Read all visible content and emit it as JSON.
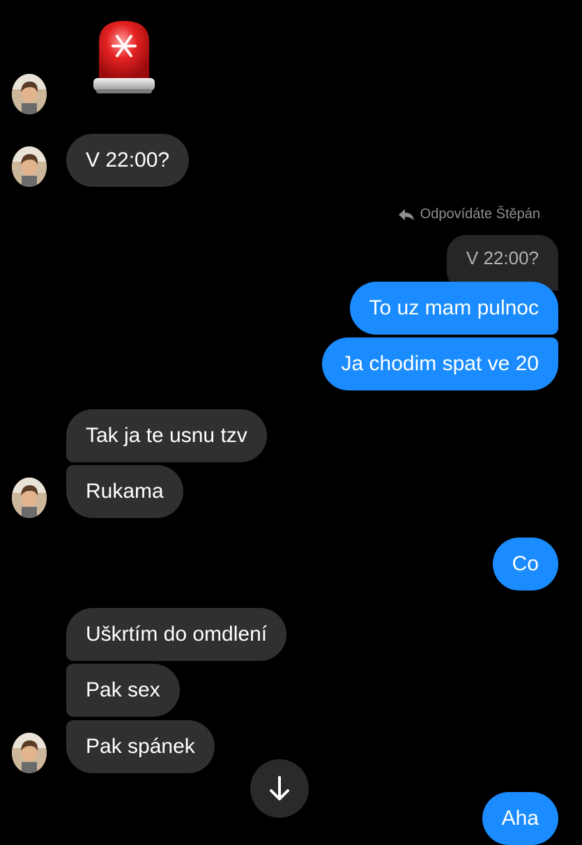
{
  "reply_label": "Odpovídáte Štěpán",
  "quoted_text": "V 22:00?",
  "messages": {
    "m1": "V 22:00?",
    "m2": "To uz mam pulnoc",
    "m3": "Ja chodim spat ve 20",
    "m4": "Tak ja te usnu tzv",
    "m5": "Rukama",
    "m6": "Co",
    "m7": "Uškrtím do omdlení",
    "m8": "Pak sex",
    "m9": "Pak spánek",
    "m10": "Aha"
  },
  "colors": {
    "background": "#000000",
    "incoming_bubble": "#303030",
    "outgoing_bubble": "#1a8cff",
    "meta_text": "#8e8e93"
  },
  "icons": {
    "emoji": "police-car-light-emoji",
    "reply": "reply-arrow-icon",
    "scroll": "arrow-down-icon"
  }
}
